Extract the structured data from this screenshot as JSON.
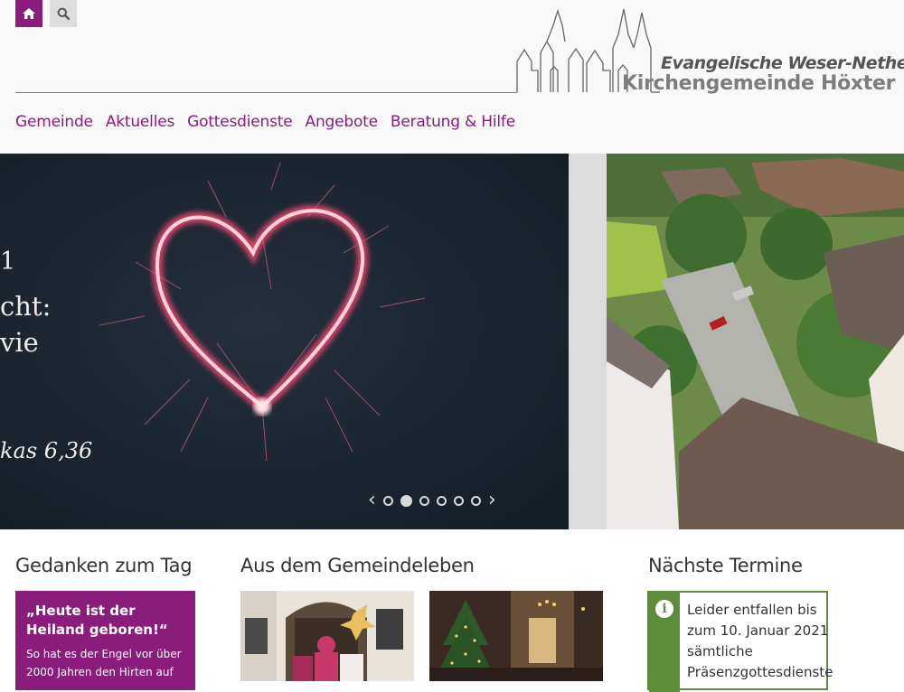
{
  "header": {
    "home_icon": "home-icon",
    "search_icon": "search-icon",
    "logo_line1": "Evangelische Weser-Nethe-",
    "logo_line2": "Kirchengemeinde Höxter"
  },
  "nav": {
    "items": [
      "Gemeinde",
      "Aktuelles",
      "Gottesdienste",
      "Angebote",
      "Beratung & Hilfe"
    ]
  },
  "slider": {
    "text_line1": "1",
    "text_line2": "cht:",
    "text_line3": "vie",
    "text_line4": "kas 6,36",
    "prev_icon": "chevron-left-icon",
    "next_icon": "chevron-right-icon",
    "slide_count": 6,
    "active_slide": 2
  },
  "sections": {
    "gedanken": {
      "heading": "Gedanken zum Tag",
      "quote_title": "„Heute ist der Heiland geboren!“",
      "quote_body": "So hat es der Engel vor über 2000 Jahren den Hirten auf"
    },
    "gemeindeleben": {
      "heading": "Aus dem Gemeindeleben"
    },
    "termine": {
      "heading": "Nächste Termine",
      "notice_icon": "info-icon",
      "notice_lines": [
        "Leider entfallen bis",
        "zum 10. Januar 2021",
        "sämtliche",
        "Präsenzgottesdienste"
      ]
    }
  },
  "colors": {
    "brand": "#8a1c7c",
    "notice": "#5d8c3a"
  }
}
